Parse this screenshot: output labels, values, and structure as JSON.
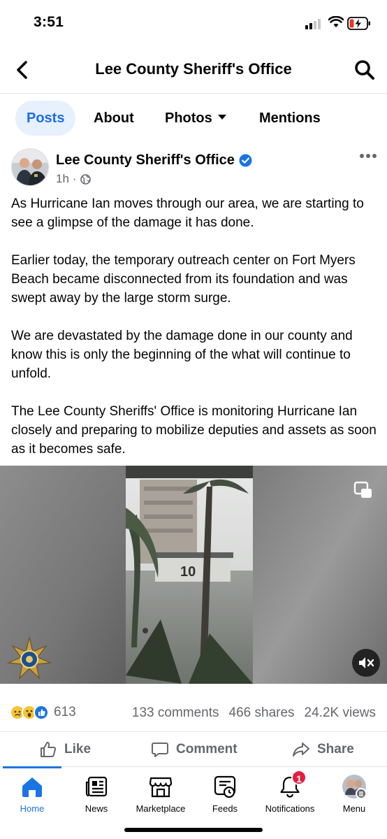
{
  "status_bar": {
    "time": "3:51"
  },
  "nav": {
    "title": "Lee County Sheriff's Office"
  },
  "tabs": [
    {
      "label": "Posts"
    },
    {
      "label": "About"
    },
    {
      "label": "Photos"
    },
    {
      "label": "Mentions"
    }
  ],
  "post": {
    "page_name": "Lee County Sheriff's Office",
    "time": "1h",
    "separator": "·",
    "paragraphs": [
      "As Hurricane Ian moves through our area, we are starting to see a glimpse of the damage it has done.",
      "Earlier today, the temporary outreach center on Fort Myers Beach became disconnected from its foundation and was swept away by the large storm surge.",
      "We are devastated by the damage done in our county and know this is only the beginning of the what will continue to unfold.",
      "The Lee County Sheriffs' Office is monitoring Hurricane Ian closely and preparing to mobilize deputies and assets as soon as it becomes safe."
    ],
    "video_sign_text": "10"
  },
  "engagement": {
    "reaction_count": "613",
    "comments": "133 comments",
    "shares": "466 shares",
    "views": "24.2K views"
  },
  "actions": {
    "like": "Like",
    "comment": "Comment",
    "share": "Share"
  },
  "tabbar": {
    "home": "Home",
    "news": "News",
    "marketplace": "Marketplace",
    "feeds": "Feeds",
    "notifications": "Notifications",
    "notifications_badge": "1",
    "menu": "Menu"
  },
  "colors": {
    "accent": "#1b74e4",
    "tab_active_bg": "#e7f0fd",
    "secondary_text": "#65676b",
    "badge_red": "#e41e3f"
  }
}
